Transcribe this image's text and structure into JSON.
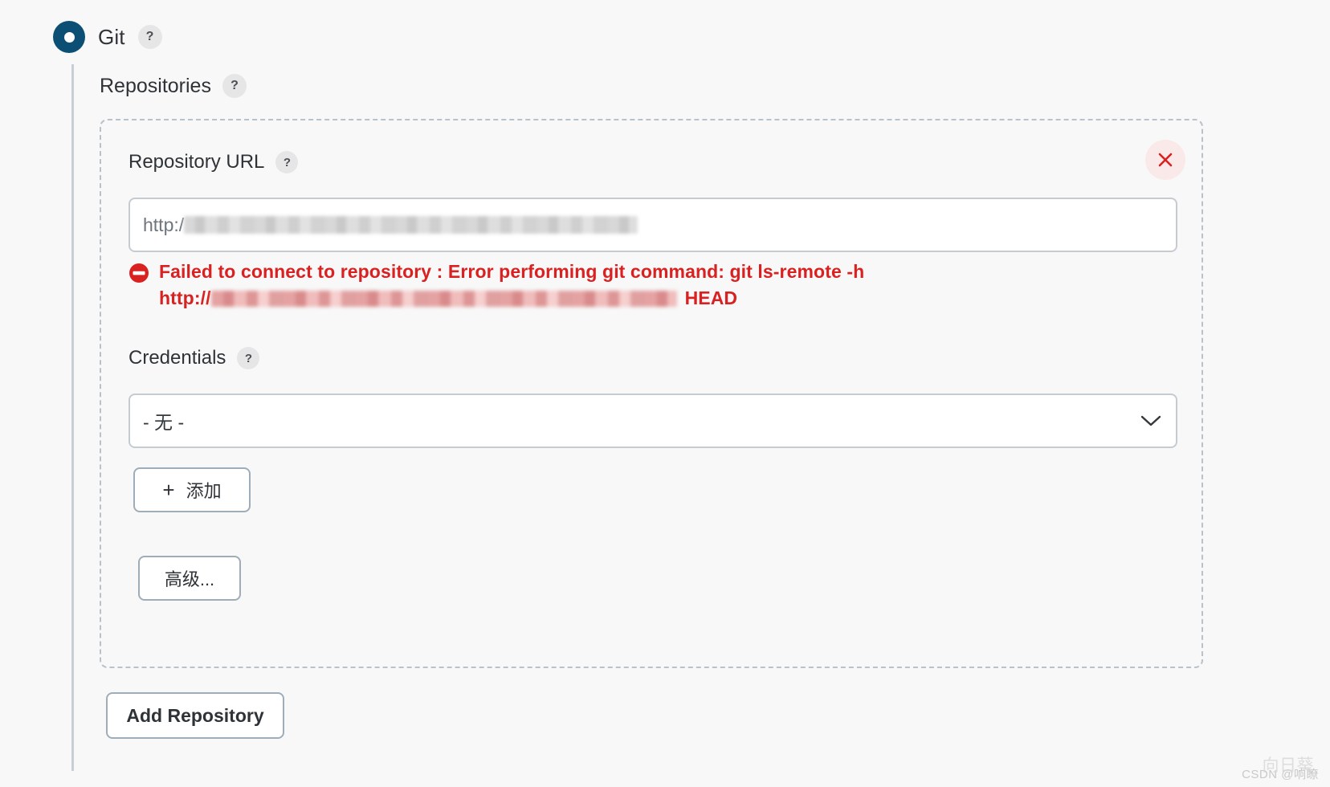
{
  "scm": {
    "selected": "Git",
    "label": "Git",
    "help": "?",
    "radio_color": "#0b4f74"
  },
  "repositories": {
    "section_title": "Repositories",
    "section_help": "?",
    "panel": {
      "close_icon": "close-icon",
      "close_color": "#d92121",
      "repository_url": {
        "label": "Repository URL",
        "help": "?",
        "value": "http:/",
        "redacted": true,
        "placeholder": ""
      },
      "error": {
        "icon": "error-circle-icon",
        "color": "#d92121",
        "line1": "Failed to connect to repository : Error performing git command: git ls-remote -h",
        "line2_prefix": "http://",
        "line2_suffix": "HEAD",
        "line2_redacted": true
      },
      "credentials": {
        "label": "Credentials",
        "help": "?",
        "selected": "- 无 -",
        "options": [
          "- 无 -"
        ],
        "chevron": "chevron-down-icon"
      },
      "add_credential_button": {
        "icon": "plus-icon",
        "label": "添加"
      },
      "advanced_button": {
        "label": "高级..."
      }
    },
    "add_repository_button": {
      "label": "Add Repository"
    }
  },
  "watermark": {
    "text": "CSDN @响瞭",
    "overlay": "向日葵"
  }
}
